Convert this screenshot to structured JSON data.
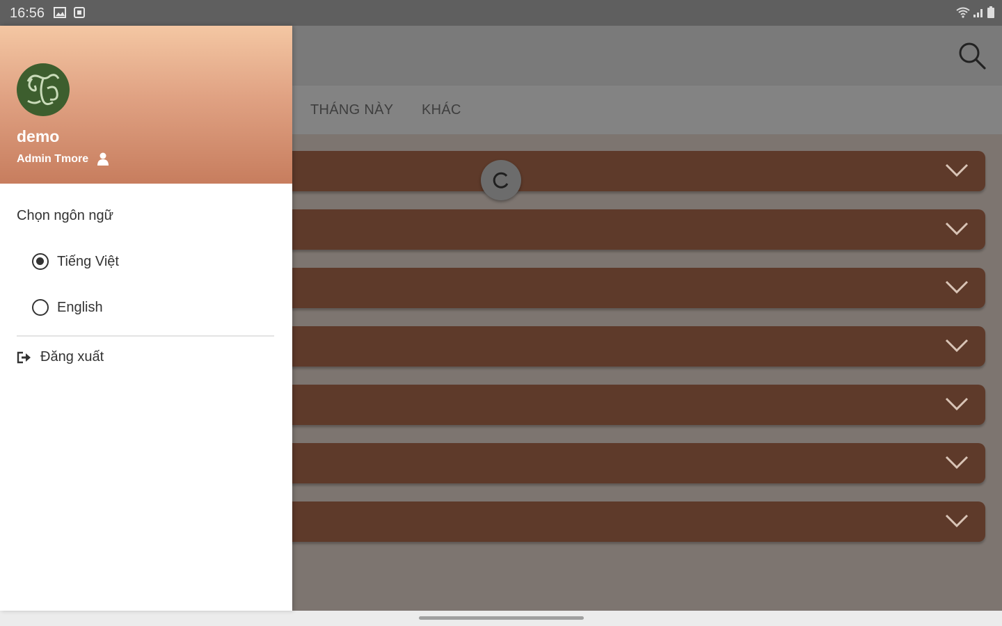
{
  "status_bar": {
    "time": "16:56"
  },
  "tabs": [
    {
      "label": "THÁNG NÀY"
    },
    {
      "label": "KHÁC"
    }
  ],
  "drawer": {
    "name": "demo",
    "subtitle": "Admin Tmore",
    "language_title": "Chọn ngôn ngữ",
    "languages": [
      {
        "label": "Tiếng Việt",
        "selected": true
      },
      {
        "label": "English",
        "selected": false
      }
    ],
    "logout_label": "Đăng xuất"
  },
  "colors": {
    "row_bg": "#5e3a2a",
    "avatar_bg": "#3d5e2e",
    "header_top": "#f4c7a3",
    "header_bottom": "#c77d5e"
  }
}
